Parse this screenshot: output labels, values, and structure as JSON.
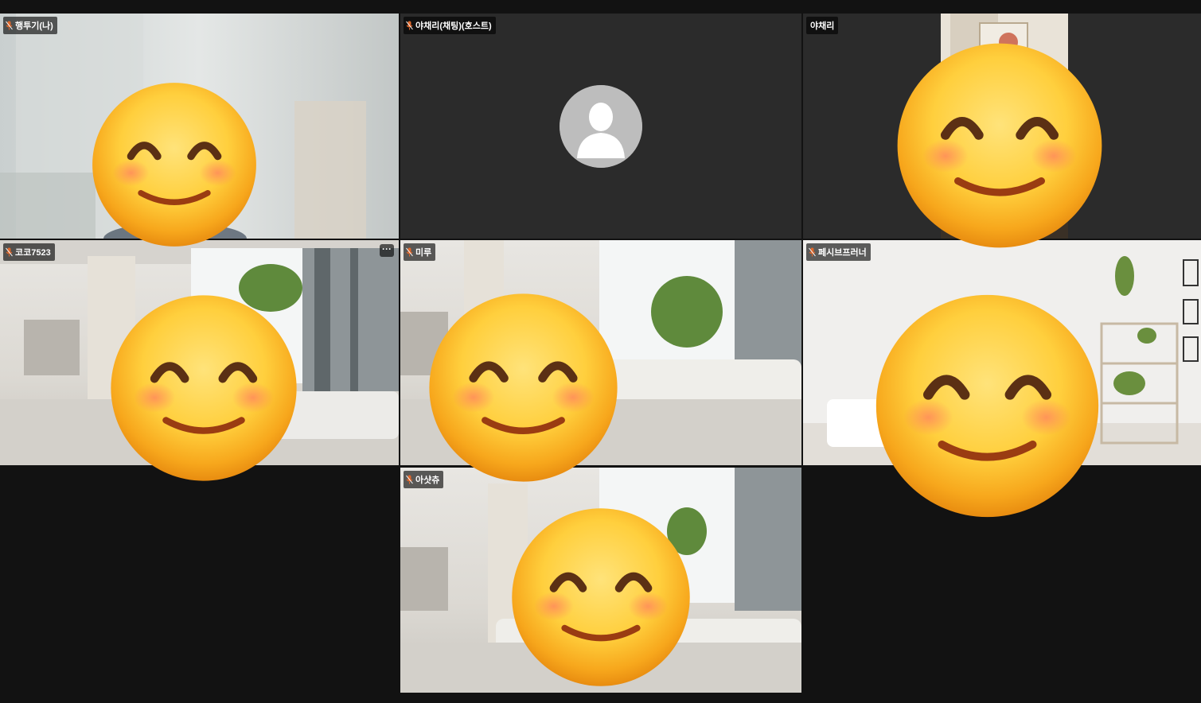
{
  "participants": [
    {
      "name": "행투기(나)",
      "muted": true,
      "video": "blurred-room",
      "face_covered": true
    },
    {
      "name": "야채리(채팅)(호스트)",
      "muted": true,
      "video": "off-avatar",
      "face_covered": false
    },
    {
      "name": "야채리",
      "muted": false,
      "video": "room-door",
      "face_covered": true
    },
    {
      "name": "코코7523",
      "muted": true,
      "video": "lobby",
      "face_covered": true,
      "more_menu": "···"
    },
    {
      "name": "미루",
      "muted": true,
      "video": "lobby",
      "face_covered": true
    },
    {
      "name": "페시브프러너",
      "muted": true,
      "video": "white-room",
      "face_covered": true
    },
    {
      "name": "아샷츄",
      "muted": true,
      "video": "lobby",
      "face_covered": true
    }
  ],
  "icons": {
    "mute": "muted-mic-icon",
    "more": "more-options-icon",
    "avatar": "default-avatar-icon",
    "emoji": "smiling-face-with-smiling-eyes-emoji"
  },
  "colors": {
    "background": "#121212",
    "tile_off": "#2b2b2b",
    "name_tag_bg": "rgba(0,0,0,0.62)",
    "mute_icon": "#e0672a"
  }
}
